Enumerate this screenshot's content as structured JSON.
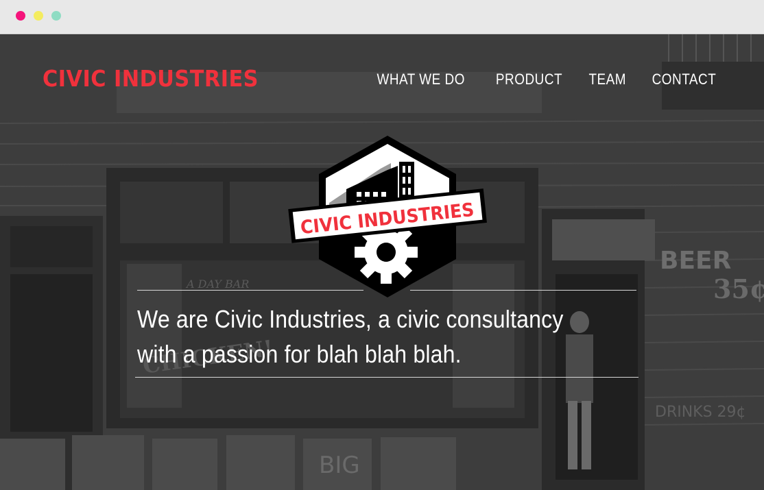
{
  "window": {
    "controls": [
      "close",
      "minimize",
      "maximize"
    ]
  },
  "header": {
    "logo_text": "CIVIC INDUSTRIES",
    "nav": [
      {
        "label": "WHAT WE DO"
      },
      {
        "label": "PRODUCT"
      },
      {
        "label": "TEAM"
      },
      {
        "label": "CONTACT"
      }
    ]
  },
  "hero": {
    "emblem_text": "CIVIC INDUSTRIES",
    "tagline": "We are Civic Industries, a civic consultancy with a passion for blah blah blah.",
    "photo_signs": [
      "BEER",
      "35¢",
      "A DAY BAR",
      "CHICKEN",
      "DRINKS 29¢",
      "BIG"
    ]
  },
  "colors": {
    "brand_red": "#f0313c",
    "text_white": "#ffffff",
    "overlay": "#3b3b3b"
  }
}
